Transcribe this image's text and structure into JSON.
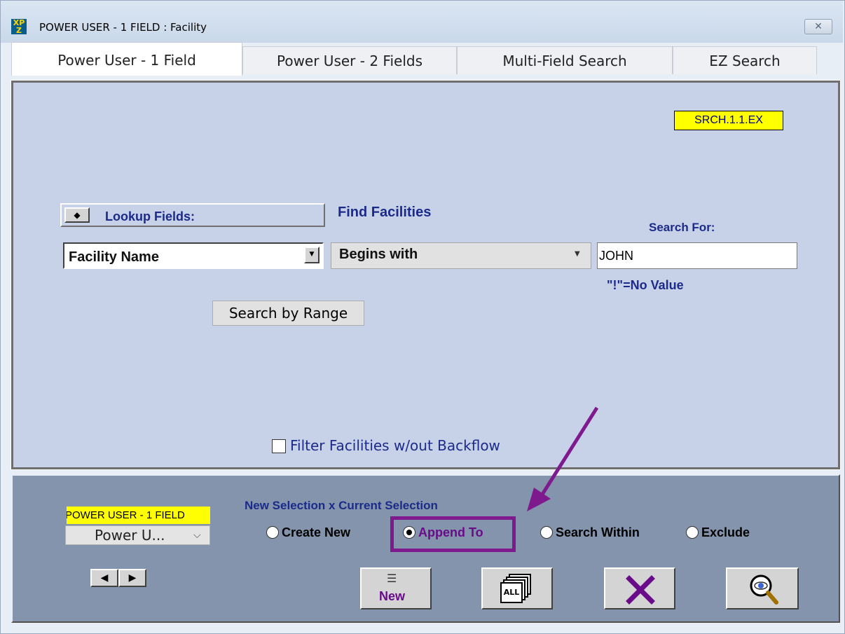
{
  "window": {
    "title": "POWER USER - 1 FIELD : Facility",
    "app_icon_text": "XP\nZ",
    "close_icon": "close-icon"
  },
  "tabs": [
    {
      "label": "Power User - 1 Field",
      "active": true
    },
    {
      "label": "Power User - 2 Fields",
      "active": false
    },
    {
      "label": "Multi-Field Search",
      "active": false
    },
    {
      "label": "EZ Search",
      "active": false
    }
  ],
  "main": {
    "screen_code": "SRCH.1.1.EX",
    "lookup_fields_label": "Lookup Fields:",
    "find_label": "Find Facilities",
    "search_for_label": "Search For:",
    "field_value": "Facility Name",
    "operator_value": "Begins with",
    "search_value": "JOHN",
    "no_value_note": "\"!\"=No Value",
    "range_button": "Search by Range",
    "filter_label": "Filter Facilities w/out Backflow",
    "filter_checked": false
  },
  "bottom": {
    "mode_label": "POWER USER - 1 FIELD",
    "mode_select_value": "Power U...",
    "selection_heading": "New Selection x Current Selection",
    "radios": [
      {
        "label": "Create New",
        "selected": false
      },
      {
        "label": "Append To",
        "selected": true
      },
      {
        "label": "Search Within",
        "selected": false
      },
      {
        "label": "Exclude",
        "selected": false
      }
    ],
    "new_button_label": "New",
    "all_button_label": "ALL",
    "accent": "#7e1a8e"
  }
}
